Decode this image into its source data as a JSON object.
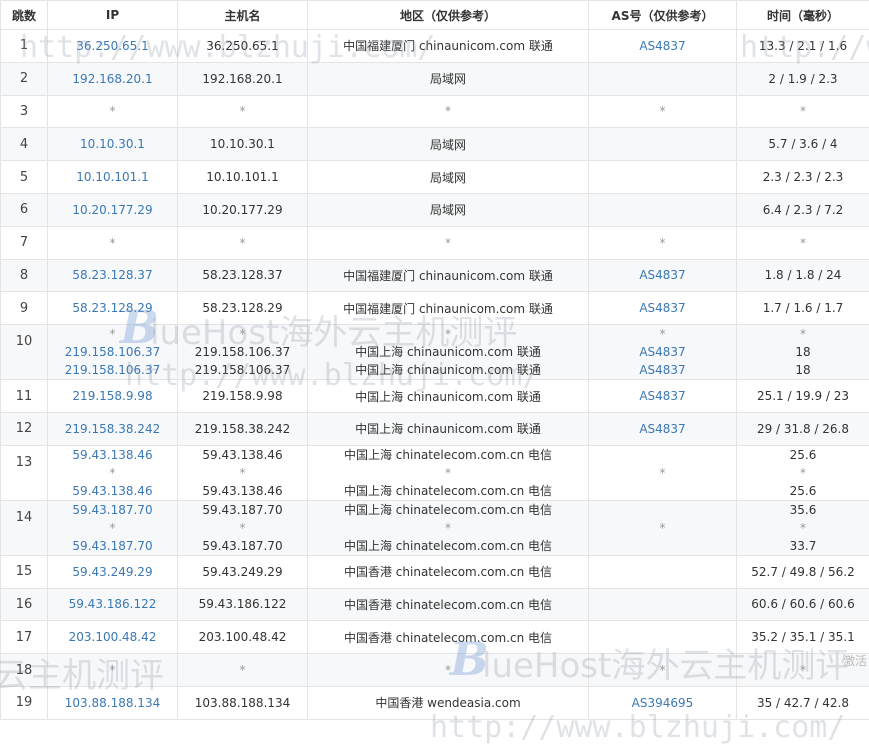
{
  "headers": {
    "hop": "跳数",
    "ip": "IP",
    "hostname": "主机名",
    "region": "地区（仅供参考）",
    "asn": "AS号（仅供参考）",
    "time": "时间（毫秒）"
  },
  "rows": [
    {
      "hop": "1",
      "ip": [
        "36.250.65.1"
      ],
      "host": [
        "36.250.65.1"
      ],
      "region": [
        "中国福建厦门 chinaunicom.com 联通"
      ],
      "asn": [
        "AS4837"
      ],
      "time": [
        "13.3 / 2.1 / 1.6"
      ]
    },
    {
      "hop": "2",
      "ip": [
        "192.168.20.1"
      ],
      "host": [
        "192.168.20.1"
      ],
      "region": [
        "局域网"
      ],
      "asn": [
        ""
      ],
      "time": [
        "2 / 1.9 / 2.3"
      ]
    },
    {
      "hop": "3",
      "ip": [
        "*"
      ],
      "host": [
        "*"
      ],
      "region": [
        "*"
      ],
      "asn": [
        "*"
      ],
      "time": [
        "*"
      ]
    },
    {
      "hop": "4",
      "ip": [
        "10.10.30.1"
      ],
      "host": [
        "10.10.30.1"
      ],
      "region": [
        "局域网"
      ],
      "asn": [
        ""
      ],
      "time": [
        "5.7 / 3.6 / 4"
      ]
    },
    {
      "hop": "5",
      "ip": [
        "10.10.101.1"
      ],
      "host": [
        "10.10.101.1"
      ],
      "region": [
        "局域网"
      ],
      "asn": [
        ""
      ],
      "time": [
        "2.3 / 2.3 / 2.3"
      ]
    },
    {
      "hop": "6",
      "ip": [
        "10.20.177.29"
      ],
      "host": [
        "10.20.177.29"
      ],
      "region": [
        "局域网"
      ],
      "asn": [
        ""
      ],
      "time": [
        "6.4 / 2.3 / 7.2"
      ]
    },
    {
      "hop": "7",
      "ip": [
        "*"
      ],
      "host": [
        "*"
      ],
      "region": [
        "*"
      ],
      "asn": [
        "*"
      ],
      "time": [
        "*"
      ]
    },
    {
      "hop": "8",
      "ip": [
        "58.23.128.37"
      ],
      "host": [
        "58.23.128.37"
      ],
      "region": [
        "中国福建厦门 chinaunicom.com 联通"
      ],
      "asn": [
        "AS4837"
      ],
      "time": [
        "1.8 / 1.8 / 24"
      ]
    },
    {
      "hop": "9",
      "ip": [
        "58.23.128.29"
      ],
      "host": [
        "58.23.128.29"
      ],
      "region": [
        "中国福建厦门 chinaunicom.com 联通"
      ],
      "asn": [
        "AS4837"
      ],
      "time": [
        "1.7 / 1.6 / 1.7"
      ]
    },
    {
      "hop": "10",
      "ip": [
        "*",
        "219.158.106.37",
        "219.158.106.37"
      ],
      "host": [
        "*",
        "219.158.106.37",
        "219.158.106.37"
      ],
      "region": [
        "*",
        "中国上海 chinaunicom.com 联通",
        "中国上海 chinaunicom.com 联通"
      ],
      "asn": [
        "*",
        "AS4837",
        "AS4837"
      ],
      "time": [
        "*",
        "18",
        "18"
      ]
    },
    {
      "hop": "11",
      "ip": [
        "219.158.9.98"
      ],
      "host": [
        "219.158.9.98"
      ],
      "region": [
        "中国上海 chinaunicom.com 联通"
      ],
      "asn": [
        "AS4837"
      ],
      "time": [
        "25.1 / 19.9 / 23"
      ]
    },
    {
      "hop": "12",
      "ip": [
        "219.158.38.242"
      ],
      "host": [
        "219.158.38.242"
      ],
      "region": [
        "中国上海 chinaunicom.com 联通"
      ],
      "asn": [
        "AS4837"
      ],
      "time": [
        "29 / 31.8 / 26.8"
      ]
    },
    {
      "hop": "13",
      "ip": [
        "59.43.138.46",
        "*",
        "59.43.138.46"
      ],
      "host": [
        "59.43.138.46",
        "*",
        "59.43.138.46"
      ],
      "region": [
        "中国上海 chinatelecom.com.cn 电信",
        "*",
        "中国上海 chinatelecom.com.cn 电信"
      ],
      "asn": [
        "*"
      ],
      "time": [
        "25.6",
        "*",
        "25.6"
      ]
    },
    {
      "hop": "14",
      "ip": [
        "59.43.187.70",
        "*",
        "59.43.187.70"
      ],
      "host": [
        "59.43.187.70",
        "*",
        "59.43.187.70"
      ],
      "region": [
        "中国上海 chinatelecom.com.cn 电信",
        "*",
        "中国上海 chinatelecom.com.cn 电信"
      ],
      "asn": [
        "*"
      ],
      "time": [
        "35.6",
        "*",
        "33.7"
      ]
    },
    {
      "hop": "15",
      "ip": [
        "59.43.249.29"
      ],
      "host": [
        "59.43.249.29"
      ],
      "region": [
        "中国香港 chinatelecom.com.cn 电信"
      ],
      "asn": [
        ""
      ],
      "time": [
        "52.7 / 49.8 / 56.2"
      ]
    },
    {
      "hop": "16",
      "ip": [
        "59.43.186.122"
      ],
      "host": [
        "59.43.186.122"
      ],
      "region": [
        "中国香港 chinatelecom.com.cn 电信"
      ],
      "asn": [
        ""
      ],
      "time": [
        "60.6 / 60.6 / 60.6"
      ]
    },
    {
      "hop": "17",
      "ip": [
        "203.100.48.42"
      ],
      "host": [
        "203.100.48.42"
      ],
      "region": [
        "中国香港 chinatelecom.com.cn 电信"
      ],
      "asn": [
        ""
      ],
      "time": [
        "35.2 / 35.1 / 35.1"
      ]
    },
    {
      "hop": "18",
      "ip": [
        "*"
      ],
      "host": [
        "*"
      ],
      "region": [
        "*"
      ],
      "asn": [
        "*"
      ],
      "time": [
        "*"
      ]
    },
    {
      "hop": "19",
      "ip": [
        "103.88.188.134"
      ],
      "host": [
        "103.88.188.134"
      ],
      "region": [
        "中国香港 wendeasia.com"
      ],
      "asn": [
        "AS394695"
      ],
      "time": [
        "35 / 42.7 / 42.8"
      ]
    }
  ],
  "watermark": {
    "url": "http://www.blzhuji.com/",
    "brand_letter": "B",
    "brand": "lueHost海外云主机测评",
    "brand_tail": "云主机测评",
    "activate": "激活"
  }
}
